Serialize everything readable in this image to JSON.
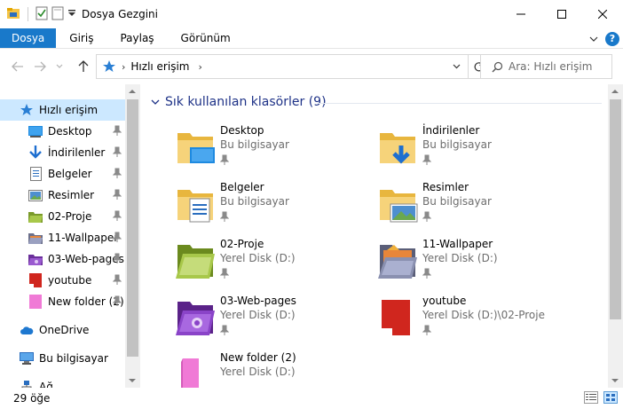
{
  "window": {
    "title": "Dosya Gezgini"
  },
  "ribbon": {
    "tabs": [
      "Dosya",
      "Giriş",
      "Paylaş",
      "Görünüm"
    ]
  },
  "address": {
    "crumb": "Hızlı erişim"
  },
  "search": {
    "placeholder": "Ara: Hızlı erişim"
  },
  "sidebar": {
    "items": [
      {
        "label": "Hızlı erişim",
        "icon": "star-icon",
        "selected": true,
        "pinned": false
      },
      {
        "label": "Desktop",
        "icon": "desktop-icon",
        "pinned": true
      },
      {
        "label": "İndirilenler",
        "icon": "download-icon",
        "pinned": true
      },
      {
        "label": "Belgeler",
        "icon": "document-icon",
        "pinned": true
      },
      {
        "label": "Resimler",
        "icon": "picture-icon",
        "pinned": true
      },
      {
        "label": "02-Proje",
        "icon": "green-folder-icon",
        "pinned": true
      },
      {
        "label": "11-Wallpaper",
        "icon": "wallpaper-folder-icon",
        "pinned": true
      },
      {
        "label": "03-Web-pages",
        "icon": "purple-folder-icon",
        "pinned": true
      },
      {
        "label": "youtube",
        "icon": "red-folder-icon",
        "pinned": true
      },
      {
        "label": "New folder (2)",
        "icon": "pink-folder-icon",
        "pinned": true
      },
      {
        "label": "OneDrive",
        "icon": "cloud-icon",
        "pinned": false
      },
      {
        "label": "Bu bilgisayar",
        "icon": "computer-icon",
        "pinned": false
      },
      {
        "label": "Ağ",
        "icon": "network-icon",
        "pinned": false
      }
    ]
  },
  "content": {
    "group_title": "Sık kullanılan klasörler (9)",
    "folders": [
      {
        "name": "Desktop",
        "location": "Bu bilgisayar",
        "icon": "desktop-folder-icon"
      },
      {
        "name": "İndirilenler",
        "location": "Bu bilgisayar",
        "icon": "downloads-folder-icon"
      },
      {
        "name": "Belgeler",
        "location": "Bu bilgisayar",
        "icon": "documents-folder-icon"
      },
      {
        "name": "Resimler",
        "location": "Bu bilgisayar",
        "icon": "pictures-folder-icon"
      },
      {
        "name": "02-Proje",
        "location": "Yerel Disk (D:)",
        "icon": "green-folder-icon"
      },
      {
        "name": "11-Wallpaper",
        "location": "Yerel Disk (D:)",
        "icon": "wallpaper-folder-icon"
      },
      {
        "name": "03-Web-pages",
        "location": "Yerel Disk (D:)",
        "icon": "purple-folder-icon"
      },
      {
        "name": "youtube",
        "location": "Yerel Disk (D:)\\02-Proje",
        "icon": "red-folder-icon"
      },
      {
        "name": "New folder (2)",
        "location": "Yerel Disk (D:)",
        "icon": "pink-folder-icon"
      }
    ]
  },
  "status": {
    "count": "29 öğe"
  },
  "colors": {
    "accent": "#1979ca",
    "selection": "#cce8ff",
    "group_header": "#1e3287"
  }
}
